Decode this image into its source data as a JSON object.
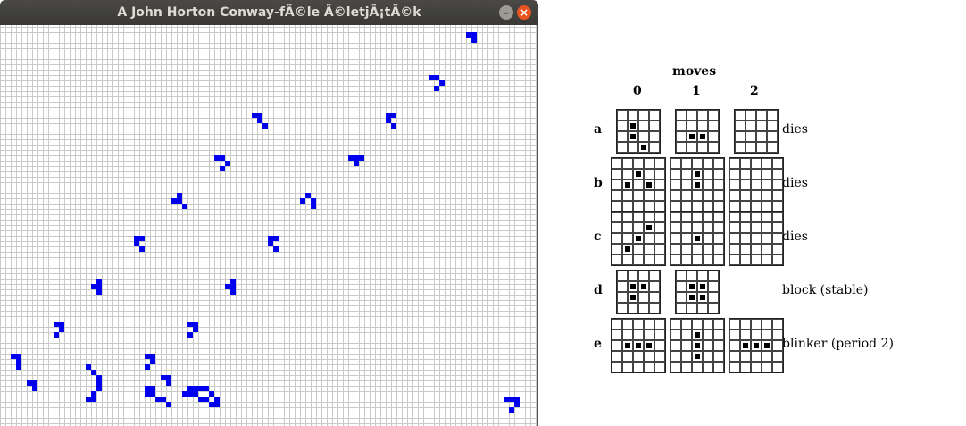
{
  "window": {
    "title": "A John Horton Conway-fÃ©le Ã©letjÃ¡tÃ©k",
    "minimize_label": "–",
    "close_label": "×"
  },
  "colors": {
    "live_cell": "#0000ee",
    "grid_line": "#c9c9c9",
    "titlebar": "#3c3b37"
  },
  "board": {
    "cell_size_note": "",
    "live_cells": [
      [
        87,
        1
      ],
      [
        88,
        1
      ],
      [
        88,
        2
      ],
      [
        80,
        9
      ],
      [
        81,
        9
      ],
      [
        82,
        10
      ],
      [
        81,
        11
      ],
      [
        47,
        16
      ],
      [
        48,
        16
      ],
      [
        48,
        17
      ],
      [
        49,
        18
      ],
      [
        72,
        16
      ],
      [
        73,
        16
      ],
      [
        72,
        17
      ],
      [
        73,
        18
      ],
      [
        40,
        24
      ],
      [
        41,
        24
      ],
      [
        42,
        25
      ],
      [
        41,
        26
      ],
      [
        65,
        24
      ],
      [
        66,
        24
      ],
      [
        67,
        24
      ],
      [
        66,
        25
      ],
      [
        33,
        31
      ],
      [
        32,
        32
      ],
      [
        33,
        32
      ],
      [
        34,
        33
      ],
      [
        57,
        31
      ],
      [
        56,
        32
      ],
      [
        58,
        32
      ],
      [
        58,
        33
      ],
      [
        25,
        39
      ],
      [
        26,
        39
      ],
      [
        25,
        40
      ],
      [
        26,
        41
      ],
      [
        50,
        39
      ],
      [
        51,
        39
      ],
      [
        50,
        40
      ],
      [
        51,
        41
      ],
      [
        18,
        47
      ],
      [
        17,
        48
      ],
      [
        18,
        48
      ],
      [
        18,
        49
      ],
      [
        43,
        47
      ],
      [
        42,
        48
      ],
      [
        43,
        48
      ],
      [
        43,
        49
      ],
      [
        10,
        55
      ],
      [
        11,
        55
      ],
      [
        11,
        56
      ],
      [
        10,
        57
      ],
      [
        35,
        55
      ],
      [
        36,
        55
      ],
      [
        36,
        56
      ],
      [
        35,
        57
      ],
      [
        2,
        61
      ],
      [
        3,
        61
      ],
      [
        3,
        62
      ],
      [
        3,
        63
      ],
      [
        5,
        66
      ],
      [
        6,
        66
      ],
      [
        6,
        67
      ],
      [
        27,
        61
      ],
      [
        28,
        61
      ],
      [
        28,
        62
      ],
      [
        27,
        63
      ],
      [
        16,
        63
      ],
      [
        17,
        64
      ],
      [
        18,
        65
      ],
      [
        18,
        66
      ],
      [
        18,
        67
      ],
      [
        17,
        68
      ],
      [
        16,
        69
      ],
      [
        17,
        69
      ],
      [
        30,
        65
      ],
      [
        31,
        65
      ],
      [
        31,
        66
      ],
      [
        27,
        67
      ],
      [
        28,
        67
      ],
      [
        27,
        68
      ],
      [
        28,
        68
      ],
      [
        29,
        69
      ],
      [
        30,
        69
      ],
      [
        31,
        70
      ],
      [
        35,
        67
      ],
      [
        36,
        67
      ],
      [
        37,
        67
      ],
      [
        38,
        67
      ],
      [
        34,
        68
      ],
      [
        35,
        68
      ],
      [
        36,
        68
      ],
      [
        39,
        68
      ],
      [
        37,
        69
      ],
      [
        38,
        69
      ],
      [
        40,
        69
      ],
      [
        39,
        70
      ],
      [
        40,
        70
      ],
      [
        94,
        69
      ],
      [
        95,
        69
      ],
      [
        96,
        69
      ],
      [
        96,
        70
      ],
      [
        95,
        71
      ]
    ]
  },
  "figure": {
    "header": "moves",
    "col_labels": [
      "0",
      "1",
      "2"
    ],
    "rows": [
      {
        "label": "a",
        "desc": "dies",
        "grids": [
          {
            "n": 4,
            "on": [
              [
                1,
                1
              ],
              [
                1,
                2
              ],
              [
                2,
                3
              ]
            ]
          },
          {
            "n": 4,
            "on": [
              [
                1,
                2
              ],
              [
                2,
                2
              ]
            ]
          },
          {
            "n": 4,
            "on": []
          }
        ]
      },
      {
        "label": "b",
        "desc": "dies",
        "grids": [
          {
            "n": 5,
            "on": [
              [
                2,
                1
              ],
              [
                1,
                2
              ],
              [
                3,
                2
              ]
            ]
          },
          {
            "n": 5,
            "on": [
              [
                2,
                1
              ],
              [
                2,
                2
              ]
            ]
          },
          {
            "n": 5,
            "on": []
          }
        ]
      },
      {
        "label": "c",
        "desc": "dies",
        "grids": [
          {
            "n": 5,
            "on": [
              [
                3,
                1
              ],
              [
                2,
                2
              ],
              [
                1,
                3
              ]
            ]
          },
          {
            "n": 5,
            "on": [
              [
                2,
                2
              ]
            ]
          },
          {
            "n": 5,
            "on": []
          }
        ]
      },
      {
        "label": "d",
        "desc": "block (stable)",
        "grids": [
          {
            "n": 4,
            "on": [
              [
                1,
                1
              ],
              [
                2,
                1
              ],
              [
                1,
                2
              ]
            ]
          },
          {
            "n": 4,
            "on": [
              [
                1,
                1
              ],
              [
                2,
                1
              ],
              [
                1,
                2
              ],
              [
                2,
                2
              ]
            ]
          }
        ]
      },
      {
        "label": "e",
        "desc": "blinker (period 2)",
        "grids": [
          {
            "n": 5,
            "on": [
              [
                1,
                2
              ],
              [
                2,
                2
              ],
              [
                3,
                2
              ]
            ]
          },
          {
            "n": 5,
            "on": [
              [
                2,
                1
              ],
              [
                2,
                2
              ],
              [
                2,
                3
              ]
            ]
          },
          {
            "n": 5,
            "on": [
              [
                1,
                2
              ],
              [
                2,
                2
              ],
              [
                3,
                2
              ]
            ]
          }
        ]
      }
    ]
  }
}
